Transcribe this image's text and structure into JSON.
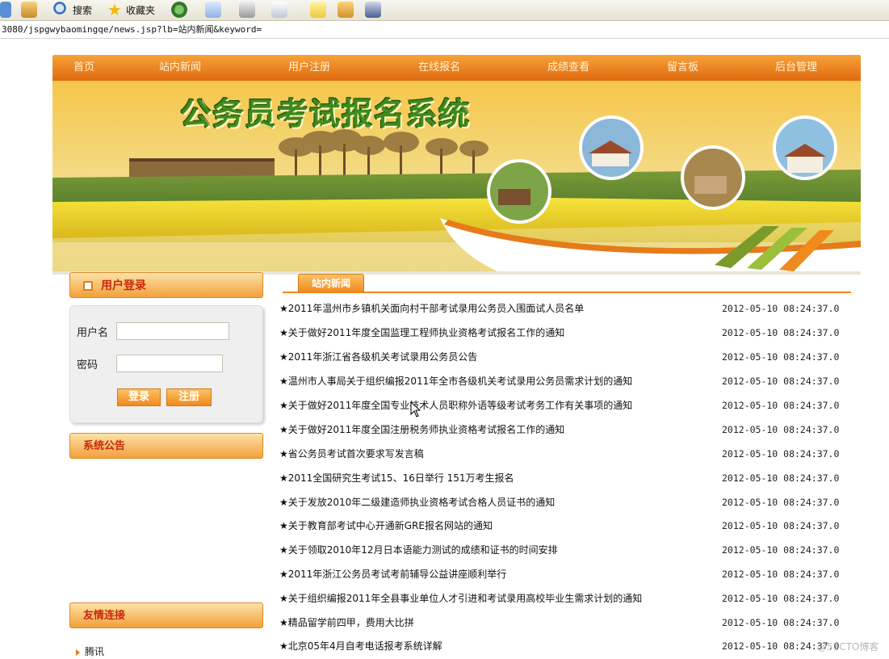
{
  "browser": {
    "toolbar": {
      "search_label": "搜索",
      "favorites_label": "收藏夹"
    },
    "address": "3080/jspgwybaomingqe/news.jsp?lb=站内新闻&keyword="
  },
  "nav": {
    "items": [
      "首页",
      "站内新闻",
      "用户注册",
      "在线报名",
      "成绩查看",
      "留言板",
      "后台管理"
    ]
  },
  "banner": {
    "title": "公务员考试报名系统"
  },
  "login": {
    "heading": "用户登录",
    "username_label": "用户名",
    "password_label": "密码",
    "username_value": "",
    "password_value": "",
    "login_button": "登录",
    "register_button": "注册"
  },
  "announcements": {
    "heading": "系统公告"
  },
  "friend_links": {
    "heading": "友情连接",
    "items": [
      "腾讯"
    ]
  },
  "news": {
    "tab_label": "站内新闻",
    "items": [
      {
        "title": "★2011年温州市乡镇机关面向村干部考试录用公务员入围面试人员名单",
        "date": "2012-05-10 08:24:37.0"
      },
      {
        "title": "★关于做好2011年度全国监理工程师执业资格考试报名工作的通知",
        "date": "2012-05-10 08:24:37.0"
      },
      {
        "title": "★2011年浙江省各级机关考试录用公务员公告",
        "date": "2012-05-10 08:24:37.0"
      },
      {
        "title": "★温州市人事局关于组织编报2011年全市各级机关考试录用公务员需求计划的通知",
        "date": "2012-05-10 08:24:37.0"
      },
      {
        "title": "★关于做好2011年度全国专业技术人员职称外语等级考试考务工作有关事项的通知",
        "date": "2012-05-10 08:24:37.0"
      },
      {
        "title": "★关于做好2011年度全国注册税务师执业资格考试报名工作的通知",
        "date": "2012-05-10 08:24:37.0"
      },
      {
        "title": "★省公务员考试首次要求写发言稿",
        "date": "2012-05-10 08:24:37.0"
      },
      {
        "title": "★2011全国研究生考试15、16日举行 151万考生报名",
        "date": "2012-05-10 08:24:37.0"
      },
      {
        "title": "★关于发放2010年二级建造师执业资格考试合格人员证书的通知",
        "date": "2012-05-10 08:24:37.0"
      },
      {
        "title": "★关于教育部考试中心开通新GRE报名网站的通知",
        "date": "2012-05-10 08:24:37.0"
      },
      {
        "title": "★关于领取2010年12月日本语能力测试的成绩和证书的时间安排",
        "date": "2012-05-10 08:24:37.0"
      },
      {
        "title": "★2011年浙江公务员考试考前辅导公益讲座顺利举行",
        "date": "2012-05-10 08:24:37.0"
      },
      {
        "title": "★关于组织编报2011年全县事业单位人才引进和考试录用高校毕业生需求计划的通知",
        "date": "2012-05-10 08:24:37.0"
      },
      {
        "title": "★精品留学前四甲，费用大比拼",
        "date": "2012-05-10 08:24:37.0"
      },
      {
        "title": "★北京05年4月自考电话报考系统详解",
        "date": "2012-05-10 08:24:37.0"
      }
    ]
  },
  "watermark": "@51CTO博客",
  "colors": {
    "nav_orange": "#e06a10",
    "accent_orange": "#ef861a",
    "title_green": "#3e8a1c",
    "heading_red": "#c8280f"
  }
}
